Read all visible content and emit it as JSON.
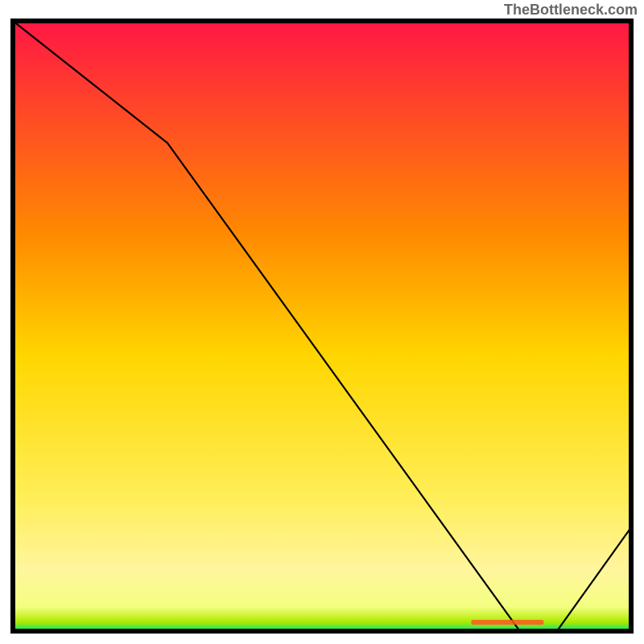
{
  "watermark": "TheBottleneck.com",
  "chart_data": {
    "type": "line",
    "title": "",
    "xlabel": "",
    "ylabel": "",
    "xlim": [
      0,
      100
    ],
    "ylim": [
      0,
      100
    ],
    "x": [
      0,
      25,
      82,
      88,
      100
    ],
    "y": [
      100,
      80,
      0,
      0,
      17
    ],
    "gradient_stops": [
      {
        "offset": 0,
        "color": "#ff1744"
      },
      {
        "offset": 0.35,
        "color": "#ff8a00"
      },
      {
        "offset": 0.55,
        "color": "#ffd600"
      },
      {
        "offset": 0.78,
        "color": "#ffee58"
      },
      {
        "offset": 0.9,
        "color": "#fff59d"
      },
      {
        "offset": 0.96,
        "color": "#f4ff81"
      },
      {
        "offset": 0.985,
        "color": "#aeea00"
      },
      {
        "offset": 1.0,
        "color": "#00e676"
      }
    ],
    "bottom_label": {
      "text": "",
      "x_rel": 0.8,
      "color": "#ff5722"
    },
    "frame_color": "#000000",
    "line_color": "#000000"
  }
}
